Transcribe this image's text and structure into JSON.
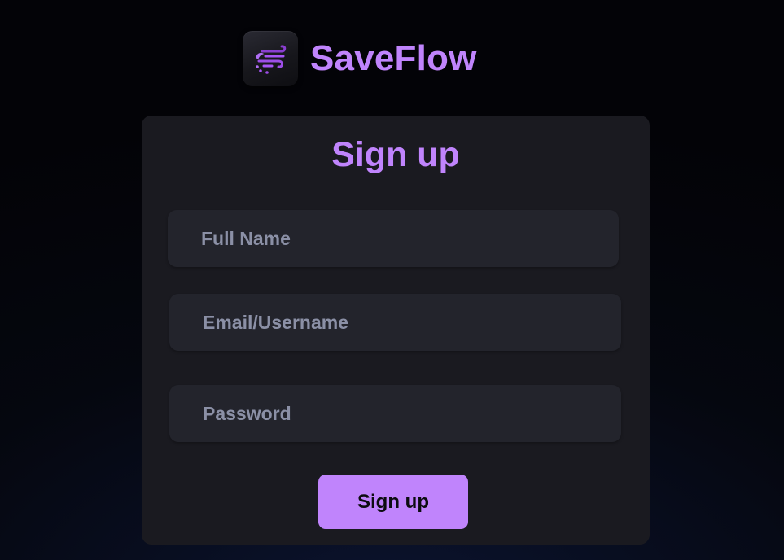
{
  "brand": {
    "name": "SaveFlow",
    "logo_icon": "saveflow-wind-logo-icon",
    "accent_color": "#c084fc"
  },
  "signup_form": {
    "title": "Sign up",
    "full_name_placeholder": "Full Name",
    "email_placeholder": "Email/Username",
    "password_placeholder": "Password",
    "submit_label": "Sign up"
  }
}
